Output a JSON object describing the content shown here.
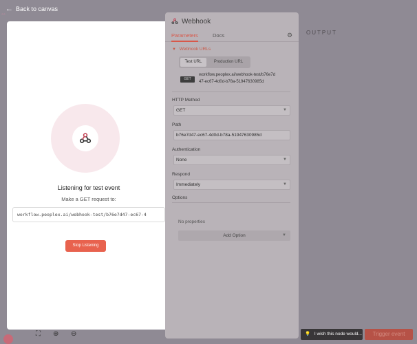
{
  "top": {
    "back_label": "Back to canvas"
  },
  "listening": {
    "title": "Listening for test event",
    "subtitle": "Make a GET request to:",
    "url": "workflow.peoplex.ai/webhook-test/b76e7d47-ec67-4",
    "stop_label": "Stop Listening"
  },
  "panel": {
    "title": "Webhook",
    "tabs": [
      "Parameters",
      "Docs"
    ],
    "webhook_urls_label": "Webhook URLs",
    "url_tabs": [
      "Test URL",
      "Production URL"
    ],
    "method_badge": "GET",
    "url_line1": "workflow.peoplex.ai/webhook-test/b76e7d",
    "url_line2": "47-ec67-4d0d-b78a-51947630985d",
    "http_method_label": "HTTP Method",
    "http_method_value": "GET",
    "path_label": "Path",
    "path_value": "b76e7d47-ec67-4d0d-b78a-51947630985d",
    "auth_label": "Authentication",
    "auth_value": "None",
    "respond_label": "Respond",
    "respond_value": "Immediately",
    "options_label": "Options",
    "no_properties": "No properties",
    "add_option": "Add Option"
  },
  "output": {
    "label": "OUTPUT"
  },
  "footer": {
    "tooltip": "I wish this node would...",
    "trigger_label": "Trigger event"
  },
  "icons": {
    "back": "arrow-left-icon",
    "webhook": "webhook-icon",
    "gear": "gear-icon",
    "chevron": "chevron-down-icon",
    "bulb": "lightbulb-icon",
    "fit": "fit-view-icon",
    "zoom_in": "zoom-in-icon",
    "zoom_out": "zoom-out-icon"
  },
  "colors": {
    "accent": "#e8624e",
    "webhook_red": "#c5495b"
  }
}
